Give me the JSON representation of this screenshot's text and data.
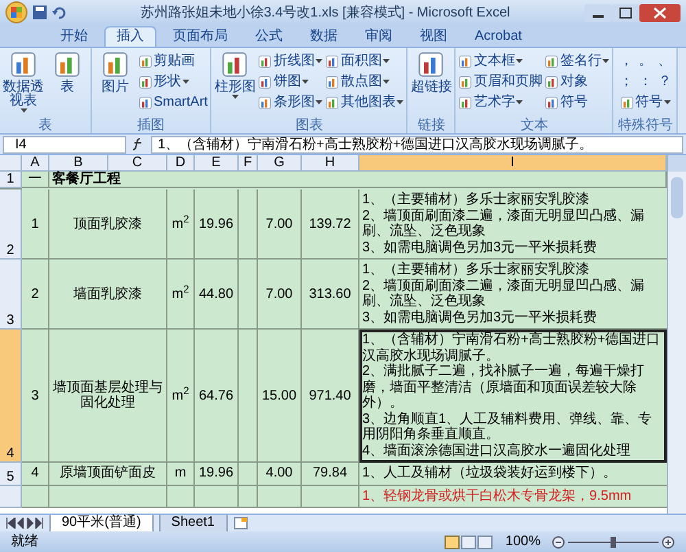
{
  "window": {
    "title": "苏州路张姐未地小徐3.4号改1.xls  [兼容模式] - Microsoft Excel"
  },
  "tabs": [
    {
      "label": "开始",
      "selected": false
    },
    {
      "label": "插入",
      "selected": true
    },
    {
      "label": "页面布局",
      "selected": false
    },
    {
      "label": "公式",
      "selected": false
    },
    {
      "label": "数据",
      "selected": false
    },
    {
      "label": "审阅",
      "selected": false
    },
    {
      "label": "视图",
      "selected": false
    },
    {
      "label": "Acrobat",
      "selected": false
    }
  ],
  "ribbon": [
    {
      "label": "表",
      "items": [
        {
          "kind": "large",
          "label": "数据透视表",
          "dropdown": true
        },
        {
          "kind": "large",
          "label": "表",
          "dropdown": false
        }
      ]
    },
    {
      "label": "插图",
      "items": [
        {
          "kind": "large",
          "label": "图片",
          "dropdown": false
        },
        {
          "kind": "small",
          "label": "剪贴画",
          "dropdown": false
        },
        {
          "kind": "small",
          "label": "形状",
          "dropdown": true
        },
        {
          "kind": "small",
          "label": "SmartArt",
          "dropdown": false
        }
      ]
    },
    {
      "label": "图表",
      "items": [
        {
          "kind": "large",
          "label": "柱形图",
          "dropdown": true
        },
        {
          "kind": "small",
          "label": "折线图",
          "dropdown": true
        },
        {
          "kind": "small",
          "label": "饼图",
          "dropdown": true
        },
        {
          "kind": "small",
          "label": "条形图",
          "dropdown": true
        },
        {
          "kind": "small",
          "label": "面积图",
          "dropdown": true
        },
        {
          "kind": "small",
          "label": "散点图",
          "dropdown": true
        },
        {
          "kind": "small",
          "label": "其他图表",
          "dropdown": true
        }
      ]
    },
    {
      "label": "链接",
      "items": [
        {
          "kind": "large",
          "label": "超链接",
          "dropdown": false
        }
      ]
    },
    {
      "label": "文本",
      "items": [
        {
          "kind": "small",
          "label": "文本框",
          "dropdown": true
        },
        {
          "kind": "small",
          "label": "页眉和页脚",
          "dropdown": false
        },
        {
          "kind": "small",
          "label": "艺术字",
          "dropdown": true
        },
        {
          "kind": "small",
          "label": "签名行",
          "dropdown": true
        },
        {
          "kind": "small",
          "label": "对象",
          "dropdown": false
        },
        {
          "kind": "small",
          "label": "符号",
          "dropdown": false
        }
      ]
    },
    {
      "label": "特殊符号",
      "items": [
        {
          "kind": "symbol",
          "label": "，"
        },
        {
          "kind": "symbol",
          "label": "。"
        },
        {
          "kind": "symbol",
          "label": "、"
        },
        {
          "kind": "symbol",
          "label": "；"
        },
        {
          "kind": "symbol",
          "label": "："
        },
        {
          "kind": "symbol",
          "label": "？"
        },
        {
          "kind": "small",
          "label": "符号",
          "dropdown": true
        }
      ]
    }
  ],
  "formula_bar": {
    "name_box": "I4",
    "formula": "1、（含辅材）宁南滑石粉+高士熟胶粉+德国进口汉高胶水现场调腻子。"
  },
  "columns": [
    {
      "label": "A",
      "selected": false
    },
    {
      "label": "B",
      "selected": false
    },
    {
      "label": "C",
      "selected": false
    },
    {
      "label": "D",
      "selected": false
    },
    {
      "label": "E",
      "selected": false
    },
    {
      "label": "F",
      "selected": false
    },
    {
      "label": "G",
      "selected": false
    },
    {
      "label": "H",
      "selected": false
    },
    {
      "label": "I",
      "selected": true
    }
  ],
  "rows": [
    {
      "number": "1",
      "selected": false,
      "kind": "heading",
      "cells": [
        "一",
        "客餐厅工程"
      ]
    },
    {
      "number": "2",
      "selected": false,
      "kind": "item",
      "cells": [
        "1",
        "顶面乳胶漆",
        "m$^{2}$",
        "19.96",
        "",
        "7.00",
        "139.72"
      ],
      "notes": [
        "1、（主要辅材）多乐士家丽安乳胶漆",
        "2、墙顶面刷面漆二遍，漆面无明显凹凸感、漏刷、流坠、泛色现象",
        "3、如需电脑调色另加3元一平米损耗费"
      ],
      "red": false
    },
    {
      "number": "3",
      "selected": false,
      "kind": "item",
      "cells": [
        "2",
        "墙面乳胶漆",
        "m$^{2}$",
        "44.80",
        "",
        "7.00",
        "313.60"
      ],
      "notes": [
        "1、（主要辅材）多乐士家丽安乳胶漆",
        "2、墙顶面刷面漆二遍，漆面无明显凹凸感、漏刷、流坠、泛色现象",
        "3、如需电脑调色另加3元一平米损耗费"
      ],
      "red": false
    },
    {
      "number": "4",
      "selected": true,
      "kind": "item",
      "cells": [
        "3",
        "墙顶面基层处理与固化处理",
        "m$^{2}$",
        "64.76",
        "",
        "15.00",
        "971.40"
      ],
      "notes": [
        "1、（含辅材）宁南滑石粉+高士熟胶粉+德国进口汉高胶水现场调腻子。",
        "2、满批腻子二遍，找补腻子一遍，每遍干燥打磨，墙面平整清洁（原墙面和顶面误差较大除外）。",
        "3、边角顺直1、人工及辅料费用、弹线、靠、专用阴阳角条垂直顺直。",
        "4、墙面滚涂德国进口汉高胶水一遍固化处理"
      ],
      "red": false
    },
    {
      "number": "5",
      "selected": false,
      "kind": "item",
      "cells": [
        "4",
        "原墙顶面铲面皮",
        "m",
        "19.96",
        "",
        "4.00",
        "79.84"
      ],
      "notes": [
        "1、人工及辅材（垃圾袋装好运到楼下）。"
      ],
      "red": false
    },
    {
      "number": "",
      "selected": false,
      "kind": "item",
      "cells": [
        "",
        "",
        "",
        "",
        "",
        "",
        ""
      ],
      "notes": [
        "1、轻钢龙骨或烘干白松木专骨龙架，9.5mm"
      ],
      "red": true
    }
  ],
  "sheet_tabs": [
    {
      "label": "90平米(普通)",
      "selected": true
    },
    {
      "label": "Sheet1",
      "selected": false
    }
  ],
  "status_bar": {
    "status": "就绪",
    "zoom": "100%"
  }
}
